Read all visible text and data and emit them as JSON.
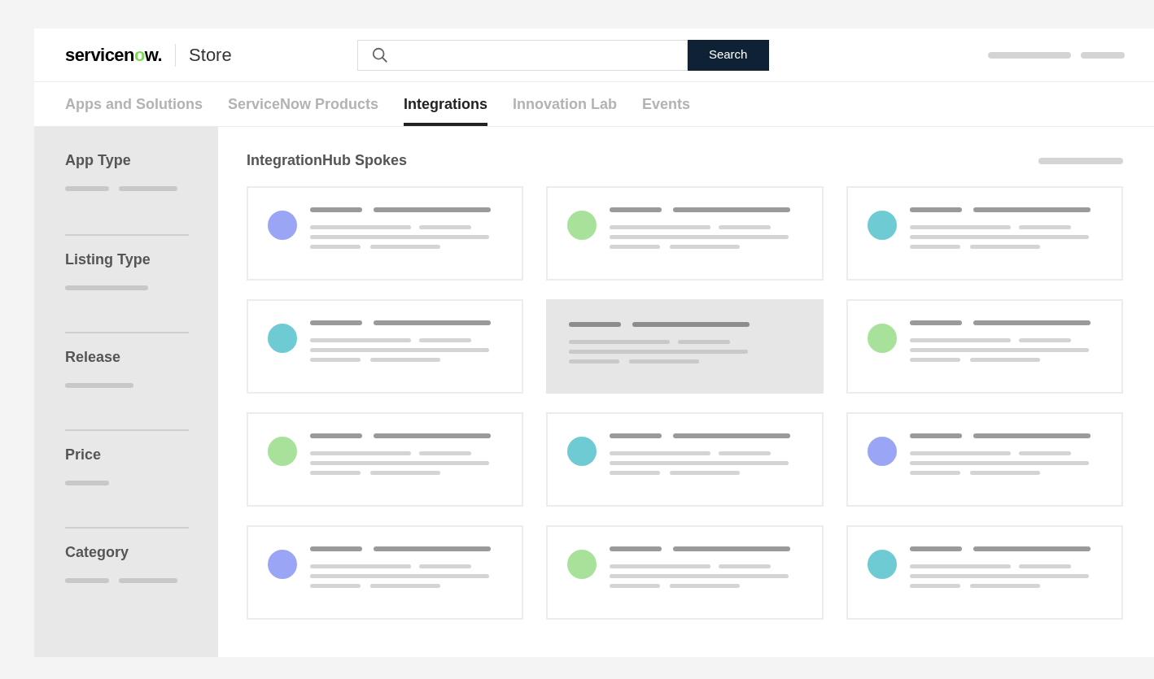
{
  "header": {
    "logo": {
      "parts": [
        {
          "text": "servicen",
          "accent": false
        },
        {
          "text": "o",
          "accent": true
        },
        {
          "text": "w.",
          "accent": false
        }
      ]
    },
    "store_label": "Store",
    "search": {
      "button": "Search"
    }
  },
  "nav_tabs": [
    {
      "label": "Apps and Solutions",
      "selected": false
    },
    {
      "label": "ServiceNow Products",
      "selected": false
    },
    {
      "label": "Integrations",
      "selected": true
    },
    {
      "label": "Innovation Lab",
      "selected": false
    },
    {
      "label": "Events",
      "selected": false
    }
  ],
  "filters": [
    {
      "label": "App Type"
    },
    {
      "label": "Listing Type"
    },
    {
      "label": "Release"
    },
    {
      "label": "Price"
    },
    {
      "label": "Category"
    }
  ],
  "section_title": "IntegrationHub Spokes",
  "cards": [
    {
      "kind": "listing",
      "color": "#9aa6f5"
    },
    {
      "kind": "listing",
      "color": "#a8e29a"
    },
    {
      "kind": "listing",
      "color": "#6ecbd3"
    },
    {
      "kind": "listing",
      "color": "#6ecbd3"
    },
    {
      "kind": "hovered"
    },
    {
      "kind": "listing",
      "color": "#a8e29a"
    },
    {
      "kind": "listing",
      "color": "#a8e29a"
    },
    {
      "kind": "listing",
      "color": "#6ecbd3"
    },
    {
      "kind": "listing",
      "color": "#9aa6f5"
    },
    {
      "kind": "listing",
      "color": "#9aa6f5"
    },
    {
      "kind": "listing",
      "color": "#a8e29a"
    },
    {
      "kind": "listing",
      "color": "#6ecbd3"
    }
  ]
}
